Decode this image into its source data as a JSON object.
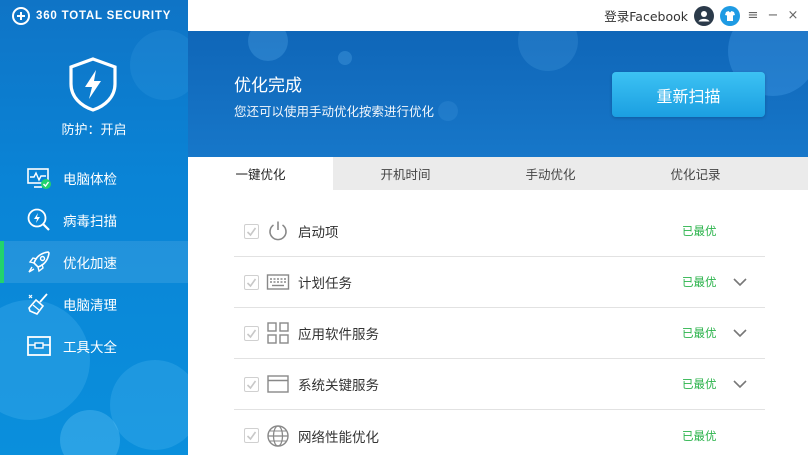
{
  "app": {
    "logo_text": "360 TOTAL SECURITY",
    "protection_status": "防护：开启"
  },
  "sidebar": {
    "items": [
      {
        "label": "电脑体检",
        "icon": "monitor-check-icon",
        "active": false
      },
      {
        "label": "病毒扫描",
        "icon": "virus-scan-icon",
        "active": false
      },
      {
        "label": "优化加速",
        "icon": "rocket-icon",
        "active": true
      },
      {
        "label": "电脑清理",
        "icon": "broom-icon",
        "active": false
      },
      {
        "label": "工具大全",
        "icon": "toolbox-icon",
        "active": false
      }
    ]
  },
  "topbar": {
    "login_label": "登录Facebook",
    "menu_symbol": "≡",
    "minimize_symbol": "−",
    "close_symbol": "×"
  },
  "banner": {
    "title": "优化完成",
    "subtitle": "您还可以使用手动优化按索进行优化",
    "rescan_label": "重新扫描"
  },
  "tabs": [
    {
      "label": "一键优化",
      "active": true
    },
    {
      "label": "开机时间",
      "active": false
    },
    {
      "label": "手动优化",
      "active": false
    },
    {
      "label": "优化记录",
      "active": false
    }
  ],
  "rows": [
    {
      "label": "启动项",
      "status": "已最优",
      "icon": "power-icon",
      "expandable": false
    },
    {
      "label": "计划任务",
      "status": "已最优",
      "icon": "keyboard-icon",
      "expandable": true
    },
    {
      "label": "应用软件服务",
      "status": "已最优",
      "icon": "apps-grid-icon",
      "expandable": true
    },
    {
      "label": "系统关键服务",
      "status": "已最优",
      "icon": "window-icon",
      "expandable": true
    },
    {
      "label": "网络性能优化",
      "status": "已最优",
      "icon": "globe-icon",
      "expandable": false
    }
  ],
  "colors": {
    "sidebar_bg": "#0a84d6",
    "active_indicator": "#22d36d",
    "status_green": "#2bb34b",
    "rescan_button": "#1b9fe1"
  }
}
